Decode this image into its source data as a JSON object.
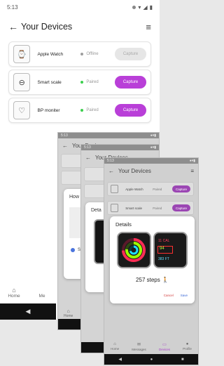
{
  "status": {
    "time": "5:13"
  },
  "header": {
    "title": "Your Devices"
  },
  "devices": [
    {
      "name": "Apple Watch",
      "status": "Offline",
      "capture": "Capture"
    },
    {
      "name": "Smart scale",
      "status": "Paired",
      "capture": "Capture"
    },
    {
      "name": "BP moniter",
      "status": "Paired",
      "capture": "Capture"
    }
  ],
  "nav": {
    "home": "Home",
    "me": "Me"
  },
  "overlay1": {
    "time": "5:13",
    "title": "Your Devices",
    "dialog_title": "How",
    "bullet": "S",
    "home": "Home"
  },
  "overlay2": {
    "time": "5:13",
    "title": "Your Devices",
    "dialog_title": "Deta"
  },
  "overlay3": {
    "time": "5:13",
    "title": "Your Devices",
    "devices": [
      {
        "name": "Apple Watch",
        "status": "Paired",
        "capture": "Capture"
      },
      {
        "name": "Smart scale",
        "status": "Paired",
        "capture": "Capture"
      }
    ],
    "details": {
      "title": "Details",
      "watch2_lines": [
        "11 CAL",
        "94",
        "383 FT"
      ],
      "steps": "257 steps",
      "cancel": "Cancel",
      "save": "Save"
    },
    "nav": [
      "Home",
      "Messages",
      "Devices",
      "Profile"
    ]
  },
  "colors": {
    "accent": "#b93fd8",
    "paired": "#3ccf4e",
    "offline": "#9e9e9e"
  }
}
